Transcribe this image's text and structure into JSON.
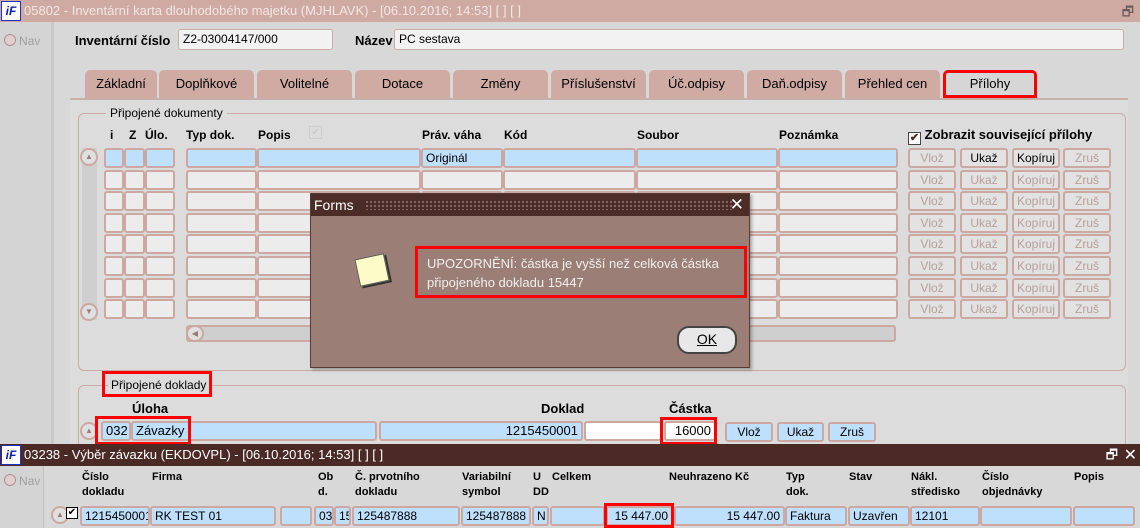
{
  "window1": {
    "title": "05802 - Inventární karta dlouhodobého majetku (MJHLAVK) - [06.10.2016; 14:53]  [ ]  [ ]",
    "logo": "iF",
    "nav": "Nav"
  },
  "header": {
    "inv_label": "Inventární číslo",
    "inv_value": "Z2-03004147/000",
    "name_label": "Název",
    "name_value": "PC sestava"
  },
  "tabs": [
    {
      "label": "Základní"
    },
    {
      "label": "Doplňkové"
    },
    {
      "label": "Volitelné"
    },
    {
      "label": "Dotace"
    },
    {
      "label": "Změny"
    },
    {
      "label": "Příslušenství"
    },
    {
      "label": "Úč.odpisy"
    },
    {
      "label": "Daň.odpisy"
    },
    {
      "label": "Přehled cen"
    },
    {
      "label": "Přílohy",
      "active": true
    }
  ],
  "documents": {
    "group_label": "Připojené dokumenty",
    "columns": [
      "i",
      "Z",
      "Úlo.",
      "Typ dok.",
      "Popis",
      "Práv. váha",
      "Kód",
      "Soubor",
      "Poznámka"
    ],
    "show_related_label": "Zobrazit související přílohy",
    "show_related_checked": true,
    "rows": [
      {
        "prav_vaha": "Originál"
      },
      {},
      {},
      {},
      {},
      {},
      {},
      {}
    ],
    "buttons": {
      "insert": "Vlož",
      "show": "Ukaž",
      "copy": "Kopíruj",
      "delete": "Zruš"
    }
  },
  "dialog": {
    "title": "Forms",
    "message_line1": "UPOZORNĚNÍ: částka je vyšší než celková částka",
    "message_line2": "připojeného dokladu 15447",
    "ok": "OK"
  },
  "linked": {
    "group_label": "Připojené doklady",
    "col_uloha": "Úloha",
    "col_doklad": "Doklad",
    "col_castka": "Částka",
    "row": {
      "code": "032",
      "task": "Závazky",
      "doklad": "1215450001",
      "castka": "16000"
    },
    "buttons": {
      "insert": "Vlož",
      "show": "Ukaž",
      "delete": "Zruš"
    }
  },
  "window2": {
    "title": "03238 - Výběr závazku (EKDOVPL) - [06.10.2016; 14:53]  [ ]  [ ]",
    "logo": "iF",
    "nav": "Nav",
    "columns": [
      "Číslo\ndokladu",
      "Firma",
      "Ob\nd.",
      "Č. prvotního\ndokladu",
      "Variabilní\nsymbol",
      "U\nDD",
      "Celkem",
      "Neuhrazeno Kč",
      "Typ\ndok.",
      "Stav",
      "Nákl.\nstředisko",
      "Číslo\nobjednávky",
      "Popis"
    ],
    "row": {
      "cislo": "1215450001",
      "firma": "RK TEST 01",
      "ob": "03",
      "d": "15",
      "prvotni": "125487888",
      "vs": "125487888",
      "udd": "N",
      "celkem": "15 447.00",
      "neuhrazeno": "15 447.00",
      "typ": "Faktura",
      "stav": "Uzavřen",
      "stredisko": "12101",
      "objednavka": "",
      "popis": "",
      "checked": true
    }
  },
  "colors": {
    "highlight": "#ff0000",
    "selected_row": "#bfe0fc",
    "title_active": "#4b2a25",
    "tab": "#cfaba4"
  }
}
